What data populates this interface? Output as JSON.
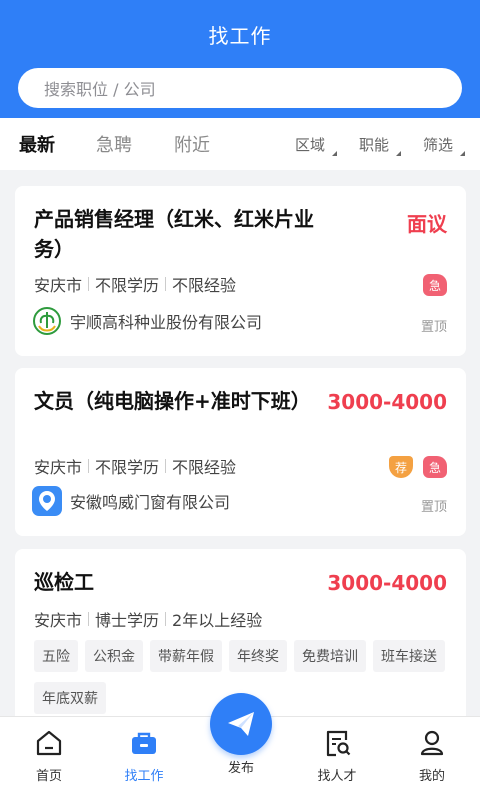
{
  "header": {
    "title": "找工作"
  },
  "search": {
    "placeholder": "搜索职位 / 公司"
  },
  "tabs": [
    {
      "label": "最新"
    },
    {
      "label": "急聘"
    },
    {
      "label": "附近"
    }
  ],
  "filters": [
    {
      "label": "区域"
    },
    {
      "label": "职能"
    },
    {
      "label": "筛选"
    }
  ],
  "jobs": [
    {
      "title": "产品销售经理（红米、红米片业务）",
      "salary": "面议",
      "city": "安庆市",
      "education": "不限学历",
      "experience": "不限经验",
      "company": "宇顺高科种业股份有限公司",
      "pin": "置顶",
      "badges": [
        "急"
      ]
    },
    {
      "title": "文员（纯电脑操作+准时下班）",
      "salary": "3000-4000",
      "city": "安庆市",
      "education": "不限学历",
      "experience": "不限经验",
      "company": "安徽鸣威门窗有限公司",
      "pin": "置顶",
      "badges": [
        "荐",
        "急"
      ]
    },
    {
      "title": "巡检工",
      "salary": "3000-4000",
      "city": "安庆市",
      "education": "博士学历",
      "experience": "2年以上经验",
      "tags": [
        "五险",
        "公积金",
        "带薪年假",
        "年终奖",
        "免费培训",
        "班车接送",
        "年底双薪"
      ]
    }
  ],
  "nav": [
    {
      "label": "首页",
      "icon": "home-icon"
    },
    {
      "label": "找工作",
      "icon": "briefcase-icon"
    },
    {
      "label": "发布",
      "icon": "paper-plane-icon"
    },
    {
      "label": "找人才",
      "icon": "search-doc-icon"
    },
    {
      "label": "我的",
      "icon": "user-icon"
    }
  ],
  "colors": {
    "primary": "#2f7ff7",
    "salary": "#ef3f4f",
    "urgent": "#f16173",
    "recommend": "#f4a142"
  }
}
